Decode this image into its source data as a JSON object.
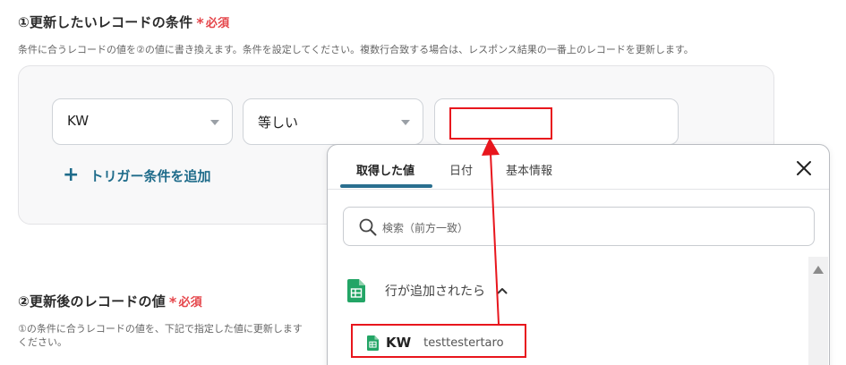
{
  "section1": {
    "title": "①更新したいレコードの条件",
    "required_label": "必須",
    "description": "条件に合うレコードの値を②の値に書き換えます。条件を設定してください。複数行合致する場合は、レスポンス結果の一番上のレコードを更新します。"
  },
  "condition": {
    "field_value": "KW",
    "operator_value": "等しい",
    "value": ""
  },
  "add_trigger": {
    "label": "トリガー条件を追加"
  },
  "section2": {
    "title": "②更新後のレコードの値",
    "required_label": "必須",
    "description_line1": "①の条件に合うレコードの値を、下記で指定した値に更新します",
    "description_line2": "ください。"
  },
  "popover": {
    "tabs": [
      {
        "label": "取得した値",
        "active": true
      },
      {
        "label": "日付",
        "active": false
      },
      {
        "label": "基本情報",
        "active": false
      }
    ],
    "search_placeholder": "検索（前方一致）",
    "group": {
      "name": "行が追加されたら",
      "expanded": true,
      "icon": "google-sheets-icon"
    },
    "items": [
      {
        "key": "KW",
        "value": "testtestertaro",
        "icon": "google-sheets-icon"
      }
    ]
  },
  "colors": {
    "accent": "#1e6b8a",
    "tab_underline": "#2a6f8f",
    "required": "#e5454a",
    "highlight": "#e8161d",
    "sheets_green": "#23a566"
  }
}
